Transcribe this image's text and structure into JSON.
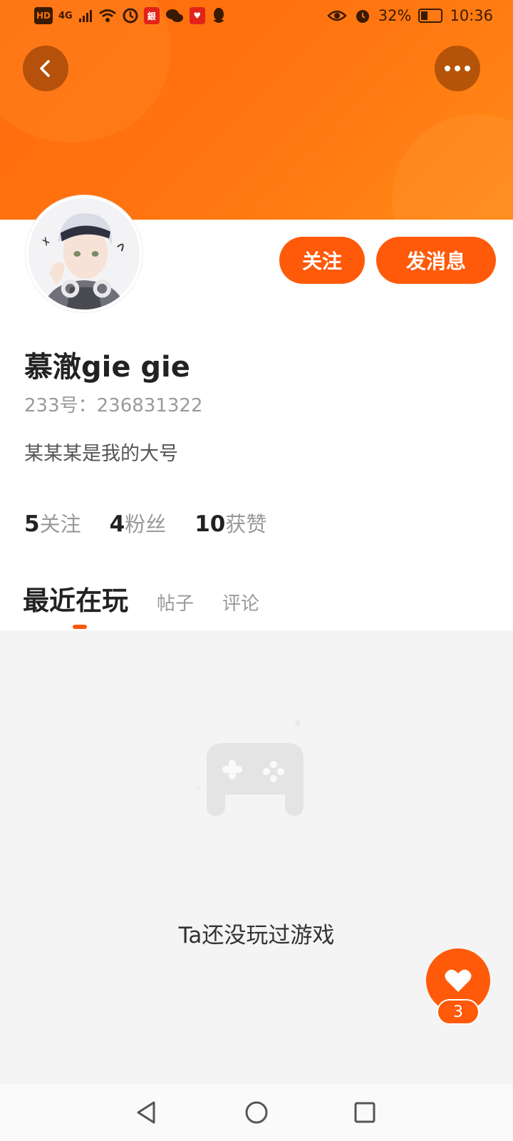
{
  "status_bar": {
    "left_icons": [
      "hd-icon",
      "signal-4g-icon",
      "wifi-icon",
      "timer-icon",
      "bank-app-icon",
      "wechat-icon",
      "heart-app-icon",
      "qq-icon"
    ],
    "hd_label": "HD",
    "net_label": "4G",
    "battery_percent": "32%",
    "time": "10:36"
  },
  "header": {
    "back_icon": "chevron-left-icon",
    "more_icon": "more-dots-icon",
    "banner_color": "#ff6a0d"
  },
  "profile": {
    "name": "慕澈gie gie",
    "id_text": "233号：236831322",
    "bio": "某某某是我的大号",
    "follow_label": "关注",
    "message_label": "发消息"
  },
  "stats": [
    {
      "value": "5",
      "label": "关注"
    },
    {
      "value": "4",
      "label": "粉丝"
    },
    {
      "value": "10",
      "label": "获赞"
    }
  ],
  "tabs": [
    {
      "label": "最近在玩",
      "active": true
    },
    {
      "label": "帖子",
      "active": false
    },
    {
      "label": "评论",
      "active": false
    }
  ],
  "empty_state": {
    "icon": "gamepad-icon",
    "message": "Ta还没玩过游戏"
  },
  "fab": {
    "icon": "heart-icon",
    "count": "3"
  },
  "nav_bar": {
    "icons": [
      "nav-back-icon",
      "nav-home-icon",
      "nav-recent-icon"
    ]
  },
  "colors": {
    "accent": "#ff5a0a",
    "content_bg": "#f4f4f4"
  }
}
